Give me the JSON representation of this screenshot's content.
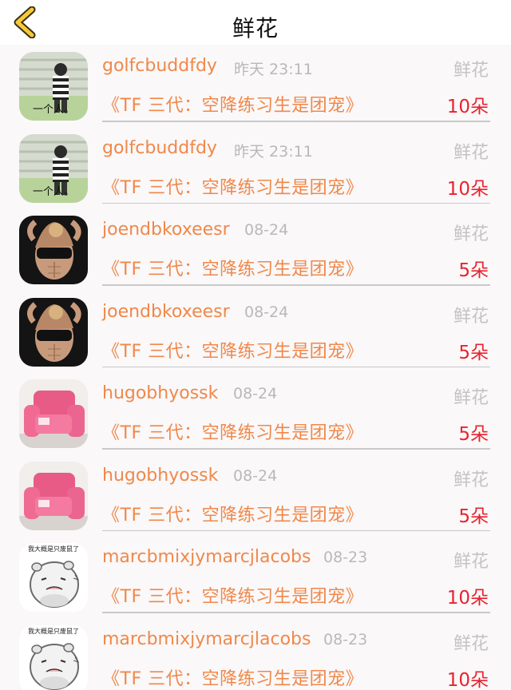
{
  "header": {
    "title": "鲜花"
  },
  "gifts": [
    {
      "user": "golfcbuddfdy",
      "time": "昨天 23:11",
      "type": "鲜花",
      "book": "《TF 三代：空降练习生是团宠》",
      "count": "10朵",
      "avatar": "striped-photo"
    },
    {
      "user": "golfcbuddfdy",
      "time": "昨天 23:11",
      "type": "鲜花",
      "book": "《TF 三代：空降练习生是团宠》",
      "count": "10朵",
      "avatar": "striped-photo"
    },
    {
      "user": "joendbkoxeesr",
      "time": "08-24",
      "type": "鲜花",
      "book": "《TF 三代：空降练习生是团宠》",
      "count": "5朵",
      "avatar": "fitness-photo"
    },
    {
      "user": "joendbkoxeesr",
      "time": "08-24",
      "type": "鲜花",
      "book": "《TF 三代：空降练习生是团宠》",
      "count": "5朵",
      "avatar": "fitness-photo"
    },
    {
      "user": "hugobhyossk",
      "time": "08-24",
      "type": "鲜花",
      "book": "《TF 三代：空降练习生是团宠》",
      "count": "5朵",
      "avatar": "pink-sofa"
    },
    {
      "user": "hugobhyossk",
      "time": "08-24",
      "type": "鲜花",
      "book": "《TF 三代：空降练习生是团宠》",
      "count": "5朵",
      "avatar": "pink-sofa"
    },
    {
      "user": "marcbmixjymarcjlacobs",
      "time": "08-23",
      "type": "鲜花",
      "book": "《TF 三代：空降练习生是团宠》",
      "count": "10朵",
      "avatar": "hamster-sticker"
    },
    {
      "user": "marcbmixjymarcjlacobs",
      "time": "08-23",
      "type": "鲜花",
      "book": "《TF 三代：空降练习生是团宠》",
      "count": "10朵",
      "avatar": "hamster-sticker"
    }
  ],
  "avatar_texts": {
    "striped": "一个人。",
    "hamster": "我大概是只废鼠了"
  }
}
